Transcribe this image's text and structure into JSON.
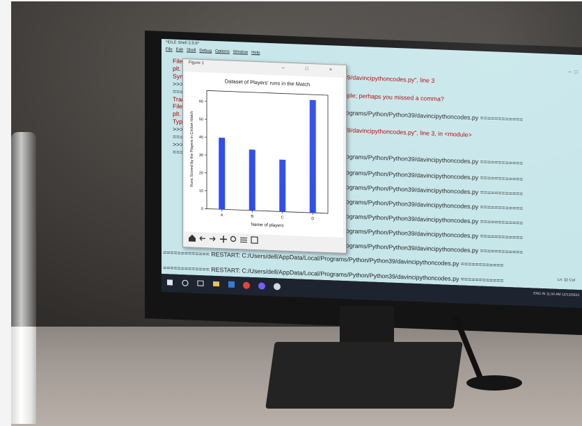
{
  "idle": {
    "window_title": "*IDLE Shell 3.9.6*",
    "menu": [
      "File",
      "Edit",
      "Shell",
      "Debug",
      "Options",
      "Window",
      "Help"
    ],
    "status_position": "Ln: 32  Col",
    "shell_lines": [
      {
        "text": "File",
        "cls": "red"
      },
      {
        "text": "plt.",
        "cls": "red"
      },
      {
        "text": "Synta",
        "cls": "red"
      },
      {
        "text": ">>>",
        "cls": ""
      },
      {
        "text": "====",
        "cls": ""
      },
      {
        "text": "Trace",
        "cls": "red"
      },
      {
        "text": "File",
        "cls": "red"
      },
      {
        "text": "plt.",
        "cls": "red"
      },
      {
        "text": "Typel",
        "cls": "red"
      },
      {
        "text": ">>>",
        "cls": ""
      },
      {
        "text": "====",
        "cls": ""
      },
      {
        "text": ">>>",
        "cls": ""
      },
      {
        "text": "====",
        "cls": ""
      }
    ],
    "right_lines": [
      {
        "text": "39/davincipythoncodes.py\", line 3",
        "cls": "red"
      },
      {
        "text": "uple; perhaps you missed a comma?",
        "cls": "red"
      },
      {
        "text": "rograms/Python/Python39/davincipythoncodes.py ============",
        "cls": ""
      },
      {
        "text": "39/davincipythoncodes.py\", line 3, in <module>",
        "cls": "red"
      },
      {
        "text": "rograms/Python/Python39/davincipythoncodes.py ============",
        "cls": ""
      },
      {
        "text": "rograms/Python/Python39/davincipythoncodes.py ============",
        "cls": ""
      },
      {
        "text": "rograms/Python/Python39/davincipythoncodes.py ============",
        "cls": ""
      },
      {
        "text": "rograms/Python/Python39/davincipythoncodes.py ============",
        "cls": ""
      },
      {
        "text": "rograms/Python/Python39/davincipythoncodes.py ============",
        "cls": ""
      },
      {
        "text": "rograms/Python/Python39/davincipythoncodes.py ============",
        "cls": ""
      },
      {
        "text": "rograms/Python/Python39/davincipythoncodes.py ============",
        "cls": ""
      }
    ],
    "restart_lines": [
      "============= RESTART: C:/Users/dell/AppData/Local/Programs/Python/Python39/davincipythoncodes.py ============",
      "============= RESTART: C:/Users/dell/AppData/Local/Programs/Python/Python39/davincipythoncodes.py ============"
    ]
  },
  "figure": {
    "window_title": "Figure 1",
    "window_controls": "– □ ×",
    "toolbar_icons": [
      "home-icon",
      "back-icon",
      "forward-icon",
      "pan-icon",
      "zoom-icon",
      "configure-icon",
      "save-icon"
    ]
  },
  "taskbar": {
    "language": "ENG",
    "region": "IN",
    "time": "11:04 AM",
    "date": "12/13/2024"
  },
  "colors": {
    "bar": "#2f4de8",
    "screen_bg": "#c6e6ea",
    "error_text": "#b00000"
  },
  "chart_data": {
    "type": "bar",
    "title": "Dataset of Players' runs in the Match",
    "xlabel": "Name of players",
    "ylabel": "Runs Scored by the Players in Cricket Match",
    "categories": [
      "A",
      "B",
      "C",
      "D"
    ],
    "values": [
      40,
      34,
      29,
      63
    ],
    "ylim": [
      0,
      66
    ],
    "yticks": [
      0,
      10,
      20,
      30,
      40,
      50,
      60
    ],
    "grid": false
  }
}
